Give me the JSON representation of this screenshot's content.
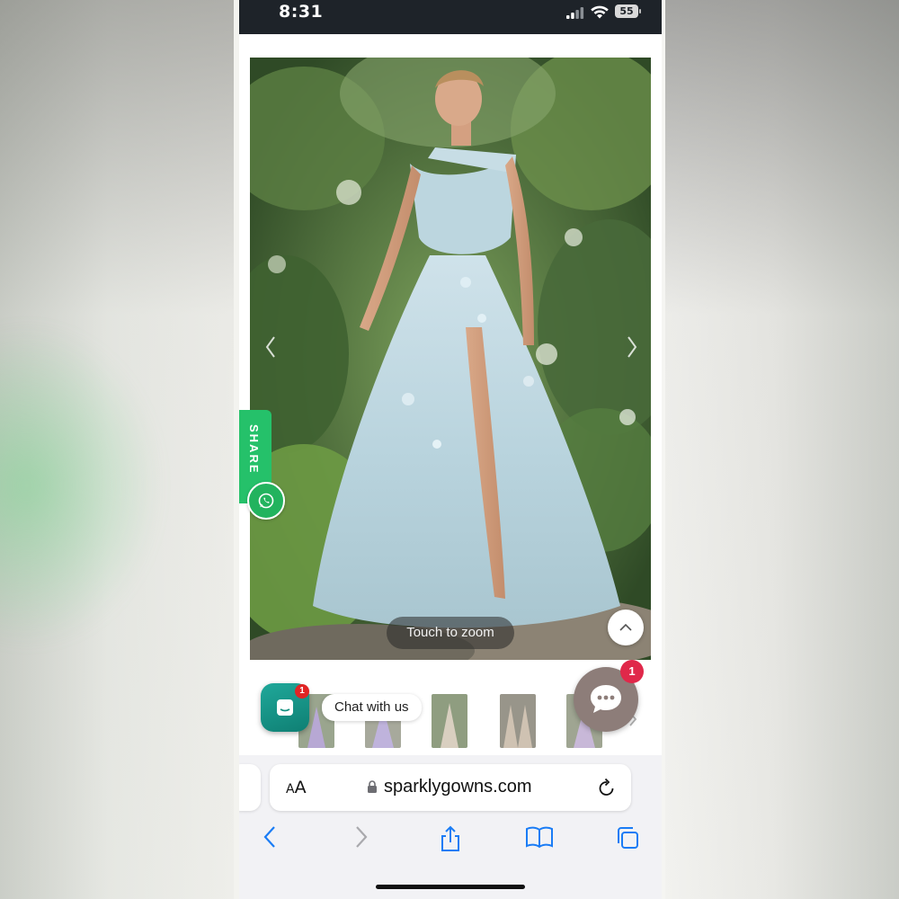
{
  "status_bar": {
    "time": "8:31",
    "battery": "55"
  },
  "product": {
    "image_alt": "Light blue one-shoulder tulle gown with floral appliqués",
    "zoom_hint": "Touch to zoom"
  },
  "share": {
    "label": "SHARE",
    "whatsapp_icon": "whatsapp-icon"
  },
  "thumbnails": [
    {
      "color": "#b7a8d4"
    },
    {
      "color": "#bfb3dc"
    },
    {
      "color": "#d9cfc0"
    },
    {
      "color": "#cfc2b2"
    },
    {
      "color": "#c8b8d8"
    }
  ],
  "chat": {
    "app_badge": "1",
    "label": "Chat with us",
    "messenger_badge": "1"
  },
  "browser": {
    "reader_label_big": "A",
    "reader_label_small": "A",
    "url": "sparklygowns.com"
  },
  "colors": {
    "accent_blue": "#1a7cf5",
    "share_green": "#25c16a",
    "chat_teal": "#13907f",
    "badge_red": "#e02424"
  }
}
